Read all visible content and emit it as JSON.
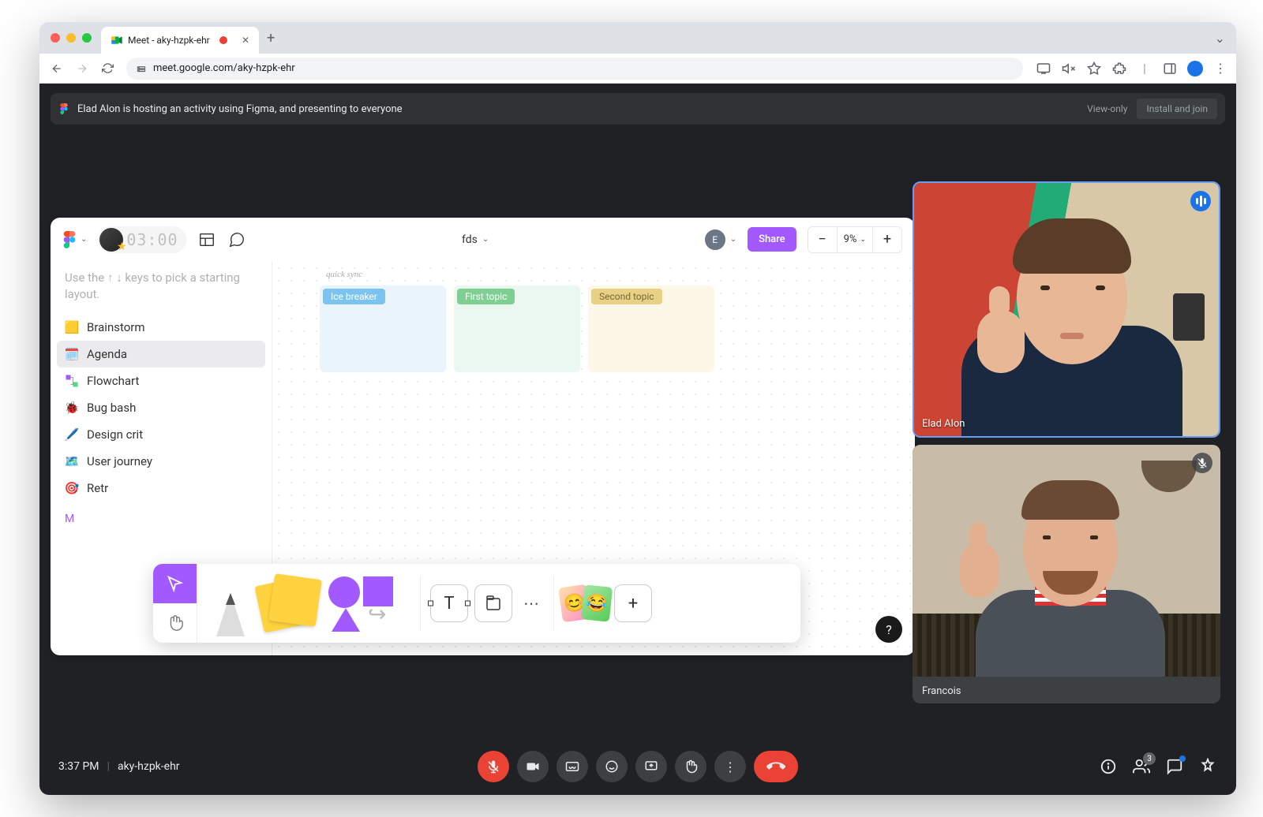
{
  "browser": {
    "tab_title": "Meet - aky-hzpk-ehr",
    "url": "meet.google.com/aky-hzpk-ehr"
  },
  "banner": {
    "text": "Elad Alon is hosting an activity using Figma, and presenting to everyone",
    "view_only": "View-only",
    "install": "Install and join"
  },
  "figma": {
    "timer": "03:00",
    "title": "fds",
    "presenter_initial": "E",
    "share_label": "Share",
    "zoom": "9%",
    "hint": "Use the ↑ ↓ keys to pick a starting layout.",
    "layouts": [
      {
        "icon": "brainstorm",
        "label": "Brainstorm"
      },
      {
        "icon": "agenda",
        "label": "Agenda"
      },
      {
        "icon": "flowchart",
        "label": "Flowchart"
      },
      {
        "icon": "bugbash",
        "label": "Bug bash"
      },
      {
        "icon": "designcrit",
        "label": "Design crit"
      },
      {
        "icon": "userjourney",
        "label": "User journey"
      },
      {
        "icon": "retro",
        "label": "Retr"
      }
    ],
    "more": "M",
    "canvas_label": "quick sync",
    "topics": [
      "Ice breaker",
      "First topic",
      "Second topic"
    ],
    "help": "?"
  },
  "participants": [
    {
      "name": "Elad Alon",
      "speaking": true,
      "muted": false
    },
    {
      "name": "Francois",
      "speaking": false,
      "muted": true
    }
  ],
  "bottom": {
    "time": "3:37 PM",
    "code": "aky-hzpk-ehr",
    "people_count": "3"
  }
}
